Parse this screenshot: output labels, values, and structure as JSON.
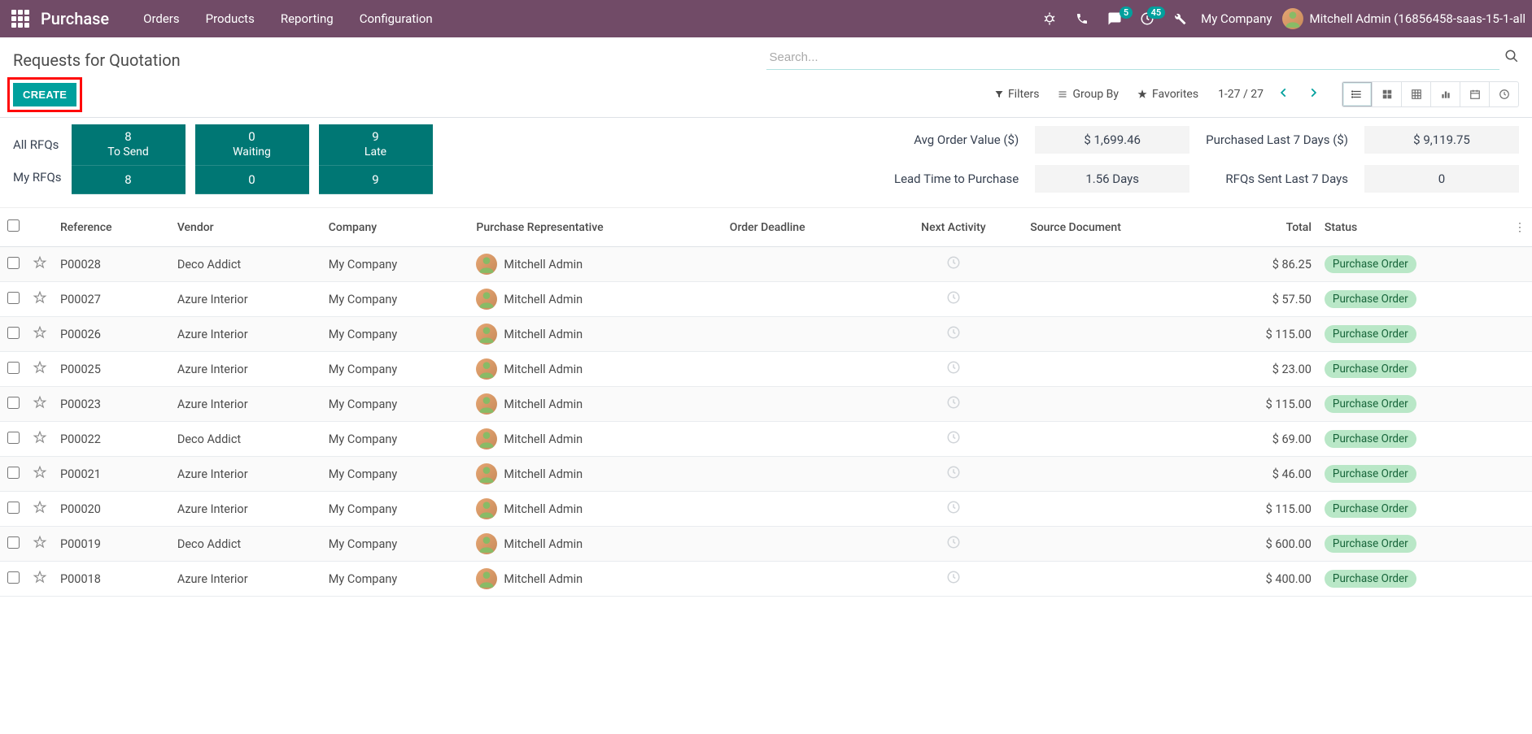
{
  "nav": {
    "brand": "Purchase",
    "items": [
      "Orders",
      "Products",
      "Reporting",
      "Configuration"
    ],
    "msg_badge": "5",
    "activity_badge": "45",
    "company": "My Company",
    "user": "Mitchell Admin (16856458-saas-15-1-all"
  },
  "cp": {
    "title": "Requests for Quotation",
    "create": "CREATE",
    "search_placeholder": "Search...",
    "filters": "Filters",
    "groupby": "Group By",
    "favorites": "Favorites",
    "pager": "1-27 / 27"
  },
  "dash": {
    "row_labels": [
      "All RFQs",
      "My RFQs"
    ],
    "cols": [
      {
        "top_num": "8",
        "top_lbl": "To Send",
        "bot": "8"
      },
      {
        "top_num": "0",
        "top_lbl": "Waiting",
        "bot": "0"
      },
      {
        "top_num": "9",
        "top_lbl": "Late",
        "bot": "9"
      }
    ],
    "kpis": {
      "avg_label": "Avg Order Value ($)",
      "avg_val": "$ 1,699.46",
      "p7_label": "Purchased Last 7 Days ($)",
      "p7_val": "$ 9,119.75",
      "lead_label": "Lead Time to Purchase",
      "lead_val": "1.56  Days",
      "sent_label": "RFQs Sent Last 7 Days",
      "sent_val": "0"
    }
  },
  "table": {
    "headers": {
      "ref": "Reference",
      "vendor": "Vendor",
      "company": "Company",
      "rep": "Purchase Representative",
      "deadline": "Order Deadline",
      "next": "Next Activity",
      "source": "Source Document",
      "total": "Total",
      "status": "Status"
    },
    "rows": [
      {
        "ref": "P00028",
        "vendor": "Deco Addict",
        "company": "My Company",
        "rep": "Mitchell Admin",
        "total": "$ 86.25",
        "status": "Purchase Order"
      },
      {
        "ref": "P00027",
        "vendor": "Azure Interior",
        "company": "My Company",
        "rep": "Mitchell Admin",
        "total": "$ 57.50",
        "status": "Purchase Order"
      },
      {
        "ref": "P00026",
        "vendor": "Azure Interior",
        "company": "My Company",
        "rep": "Mitchell Admin",
        "total": "$ 115.00",
        "status": "Purchase Order"
      },
      {
        "ref": "P00025",
        "vendor": "Azure Interior",
        "company": "My Company",
        "rep": "Mitchell Admin",
        "total": "$ 23.00",
        "status": "Purchase Order"
      },
      {
        "ref": "P00023",
        "vendor": "Azure Interior",
        "company": "My Company",
        "rep": "Mitchell Admin",
        "total": "$ 115.00",
        "status": "Purchase Order"
      },
      {
        "ref": "P00022",
        "vendor": "Deco Addict",
        "company": "My Company",
        "rep": "Mitchell Admin",
        "total": "$ 69.00",
        "status": "Purchase Order"
      },
      {
        "ref": "P00021",
        "vendor": "Azure Interior",
        "company": "My Company",
        "rep": "Mitchell Admin",
        "total": "$ 46.00",
        "status": "Purchase Order"
      },
      {
        "ref": "P00020",
        "vendor": "Azure Interior",
        "company": "My Company",
        "rep": "Mitchell Admin",
        "total": "$ 115.00",
        "status": "Purchase Order"
      },
      {
        "ref": "P00019",
        "vendor": "Deco Addict",
        "company": "My Company",
        "rep": "Mitchell Admin",
        "total": "$ 600.00",
        "status": "Purchase Order"
      },
      {
        "ref": "P00018",
        "vendor": "Azure Interior",
        "company": "My Company",
        "rep": "Mitchell Admin",
        "total": "$ 400.00",
        "status": "Purchase Order"
      }
    ]
  }
}
